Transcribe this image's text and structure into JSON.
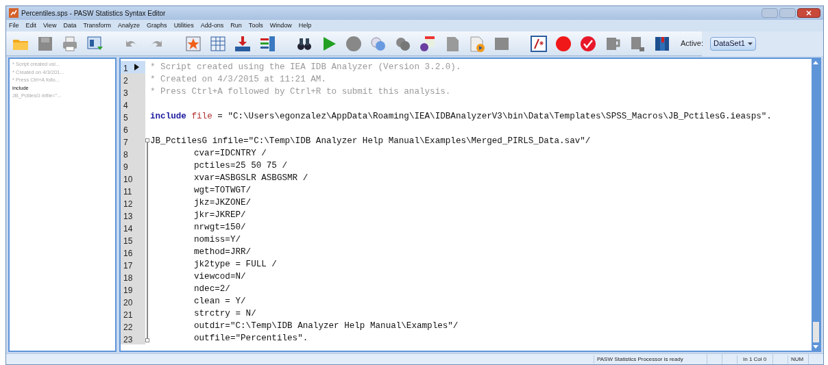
{
  "window": {
    "title": "Percentiles.sps - PASW Statistics Syntax Editor"
  },
  "menu": [
    "File",
    "Edit",
    "View",
    "Data",
    "Transform",
    "Analyze",
    "Graphs",
    "Utilities",
    "Add-ons",
    "Run",
    "Tools",
    "Window",
    "Help"
  ],
  "toolbar": {
    "active_label": "Active:",
    "active_dataset": "DataSet1"
  },
  "navigator": [
    {
      "text": "* Script created usi...",
      "kind": "comment"
    },
    {
      "text": "* Created on 4/3/201...",
      "kind": "comment"
    },
    {
      "text": "* Press Ctrl+A follo...",
      "kind": "comment"
    },
    {
      "text": "include",
      "kind": "command"
    },
    {
      "text": "JB_PctilesG infile=\"...",
      "kind": "comment"
    }
  ],
  "editor": {
    "lines": [
      {
        "number": "1",
        "current": true,
        "segments": [
          {
            "kind": "comment",
            "text": "* Script created using the IEA IDB Analyzer (Version 3.2.0)."
          }
        ]
      },
      {
        "number": "2",
        "current": false,
        "segments": [
          {
            "kind": "comment",
            "text": "* Created on 4/3/2015 at 11:21 AM."
          }
        ]
      },
      {
        "number": "3",
        "current": false,
        "segments": [
          {
            "kind": "comment",
            "text": "* Press Ctrl+A followed by Ctrl+R to submit this analysis."
          }
        ]
      },
      {
        "number": "4",
        "current": false
      },
      {
        "number": "5",
        "current": false,
        "segments": [
          {
            "kind": "keyword",
            "text": "include"
          },
          {
            "kind": "subcommand",
            "text": " file"
          },
          {
            "kind": "plain",
            "text": " = \"C:\\Users\\egonzalez\\AppData\\Roaming\\IEA\\IDBAnalyzerV3\\bin\\Data\\Templates\\SPSS_Macros\\JB_PctilesG.ieasps\"."
          }
        ]
      },
      {
        "number": "6",
        "current": false
      },
      {
        "number": "7",
        "current": false,
        "fold_start": true,
        "segments": [
          {
            "kind": "plain",
            "text": "JB_PctilesG infile=\"C:\\Temp\\IDB Analyzer Help Manual\\Examples\\Merged_PIRLS_Data.sav\"/"
          }
        ]
      },
      {
        "number": "8",
        "current": false,
        "segments": [
          {
            "kind": "indented",
            "text": "cvar=IDCNTRY /"
          }
        ]
      },
      {
        "number": "9",
        "current": false,
        "segments": [
          {
            "kind": "indented",
            "text": "pctiles=25 50 75 /"
          }
        ]
      },
      {
        "number": "10",
        "current": false,
        "segments": [
          {
            "kind": "indented",
            "text": "xvar=ASBGSLR ASBGSMR /"
          }
        ]
      },
      {
        "number": "11",
        "current": false,
        "segments": [
          {
            "kind": "indented",
            "text": "wgt=TOTWGT/"
          }
        ]
      },
      {
        "number": "12",
        "current": false,
        "segments": [
          {
            "kind": "indented",
            "text": "jkz=JKZONE/"
          }
        ]
      },
      {
        "number": "13",
        "current": false,
        "segments": [
          {
            "kind": "indented",
            "text": "jkr=JKREP/"
          }
        ]
      },
      {
        "number": "14",
        "current": false,
        "segments": [
          {
            "kind": "indented",
            "text": "nrwgt=150/"
          }
        ]
      },
      {
        "number": "15",
        "current": false,
        "segments": [
          {
            "kind": "indented",
            "text": "nomiss=Y/"
          }
        ]
      },
      {
        "number": "16",
        "current": false,
        "segments": [
          {
            "kind": "indented",
            "text": "method=JRR/"
          }
        ]
      },
      {
        "number": "17",
        "current": false,
        "segments": [
          {
            "kind": "indented",
            "text": "jk2type = FULL /"
          }
        ]
      },
      {
        "number": "18",
        "current": false,
        "segments": [
          {
            "kind": "indented",
            "text": "viewcod=N/"
          }
        ]
      },
      {
        "number": "19",
        "current": false,
        "segments": [
          {
            "kind": "indented",
            "text": "ndec=2/"
          }
        ]
      },
      {
        "number": "20",
        "current": false,
        "segments": [
          {
            "kind": "indented",
            "text": "clean = Y/"
          }
        ]
      },
      {
        "number": "21",
        "current": false,
        "segments": [
          {
            "kind": "indented",
            "text": "strctry = N/"
          }
        ]
      },
      {
        "number": "22",
        "current": false,
        "segments": [
          {
            "kind": "indented",
            "text": "outdir=\"C:\\Temp\\IDB Analyzer Help Manual\\Examples\"/"
          }
        ]
      },
      {
        "number": "23",
        "current": false,
        "fold_end": true,
        "segments": [
          {
            "kind": "indented",
            "text": "outfile=\"Percentiles\"."
          }
        ]
      }
    ]
  },
  "status_bar": {
    "message": "PASW Statistics Processor is ready",
    "position": "In 1 Col 0",
    "num": "NUM"
  }
}
